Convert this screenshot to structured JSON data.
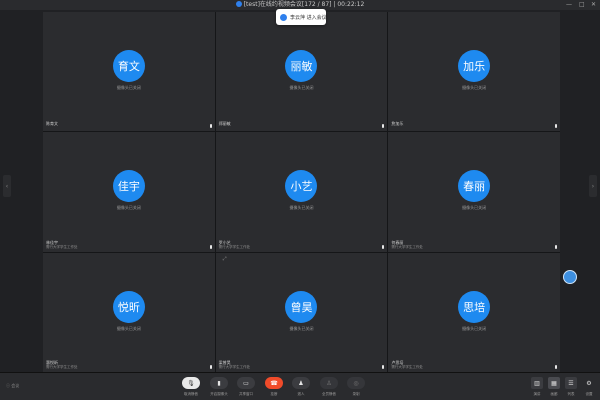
{
  "window": {
    "title": "[test]在线约视频会议[172 / 87] | 00:22:12",
    "controls": [
      "—",
      "□",
      "✕"
    ]
  },
  "toast": {
    "text": "李云萍 进入会议"
  },
  "participants": [
    {
      "avatar": "育文",
      "status": "摄像头已关闭",
      "name": "陈育文",
      "dept": ""
    },
    {
      "avatar": "丽敏",
      "status": "摄像头已关闭",
      "name": "郑丽敏",
      "dept": ""
    },
    {
      "avatar": "加乐",
      "status": "摄像头已关闭",
      "name": "詹加乐",
      "dept": ""
    },
    {
      "avatar": "佳宇",
      "status": "摄像头已关闭",
      "name": "林佳宇",
      "dept": "需行大学学生工作处"
    },
    {
      "avatar": "小艺",
      "status": "摄像头已关闭",
      "name": "罗小艺",
      "dept": "需行大学学生工作处"
    },
    {
      "avatar": "春丽",
      "status": "摄像头已关闭",
      "name": "何春丽",
      "dept": "需行大学学生工作处"
    },
    {
      "avatar": "悦昕",
      "status": "摄像头已关闭",
      "name": "惠悦昕",
      "dept": "需行大学学生工作处"
    },
    {
      "avatar": "曾昊",
      "status": "摄像头已关闭",
      "name": "梁曾昊",
      "dept": "需行大学学生工作处"
    },
    {
      "avatar": "思培",
      "status": "摄像头已关闭",
      "name": "卢思培",
      "dept": "需行大学学生工作处"
    }
  ],
  "toolbar": {
    "left_label": "会议",
    "buttons": [
      {
        "label": "取消静音",
        "icon": "mic-icon"
      },
      {
        "label": "开启摄像头",
        "icon": "camera-icon"
      },
      {
        "label": "共享窗口",
        "icon": "share-screen-icon"
      },
      {
        "label": "挂断",
        "icon": "hangup-icon"
      },
      {
        "label": "邀人",
        "icon": "invite-icon"
      },
      {
        "label": "全员静音",
        "icon": "mute-all-icon"
      },
      {
        "label": "录制",
        "icon": "record-icon"
      }
    ],
    "layouts": [
      {
        "label": "演讲"
      },
      {
        "label": "画廊"
      },
      {
        "label": "列表"
      },
      {
        "label": "设置"
      }
    ]
  },
  "colors": {
    "avatar": "#1e8af0",
    "hangup": "#f04b2a",
    "background": "#202124"
  }
}
